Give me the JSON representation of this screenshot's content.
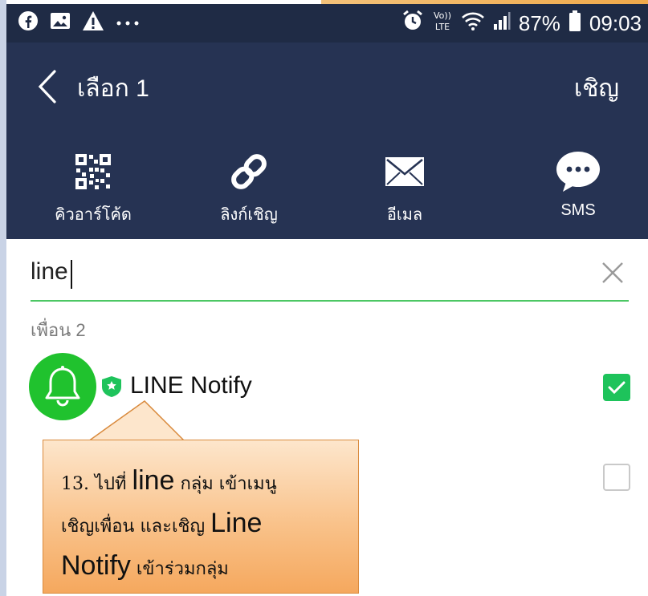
{
  "status_bar": {
    "battery_percent": "87%",
    "time": "09:03",
    "network_label": "VoLTE",
    "left_icons": [
      "facebook-icon",
      "gallery-icon",
      "warning-icon",
      "more-icon"
    ],
    "right_icons": [
      "alarm-icon",
      "volte-icon",
      "wifi-icon",
      "signal-icon",
      "battery-icon"
    ]
  },
  "header": {
    "title": "เลือก 1",
    "invite_label": "เชิญ"
  },
  "share_options": [
    {
      "label": "คิวอาร์โค้ด",
      "icon": "qr-code-icon"
    },
    {
      "label": "ลิงก์เชิญ",
      "icon": "link-icon"
    },
    {
      "label": "อีเมล",
      "icon": "mail-icon"
    },
    {
      "label": "SMS",
      "icon": "sms-bubble-icon"
    }
  ],
  "search": {
    "value": "line",
    "clear_icon": "close-icon"
  },
  "section": {
    "label": "เพื่อน 2"
  },
  "friends": [
    {
      "name": "LINE Notify",
      "checked": true,
      "avatar_icon": "bell-icon",
      "badge_icon": "official-shield-icon"
    },
    {
      "name": "",
      "checked": false
    }
  ],
  "callout": {
    "line1_prefix": "13. ไปที่ ",
    "line1_big": "line",
    "line1_suffix": " กลุ่ม เข้าเมนู",
    "line2_prefix": "เชิญเพื่อน และเชิญ ",
    "line2_big": "Line",
    "line3_big": "Notify",
    "line3_suffix": " เข้าร่วมกลุ่ม"
  },
  "colors": {
    "status_bar": "#1f2b45",
    "header": "#263353",
    "accent_green": "#4cc764",
    "avatar_green": "#20c22e",
    "check_green": "#1ec35b",
    "callout_orange": "#f5a85e"
  }
}
